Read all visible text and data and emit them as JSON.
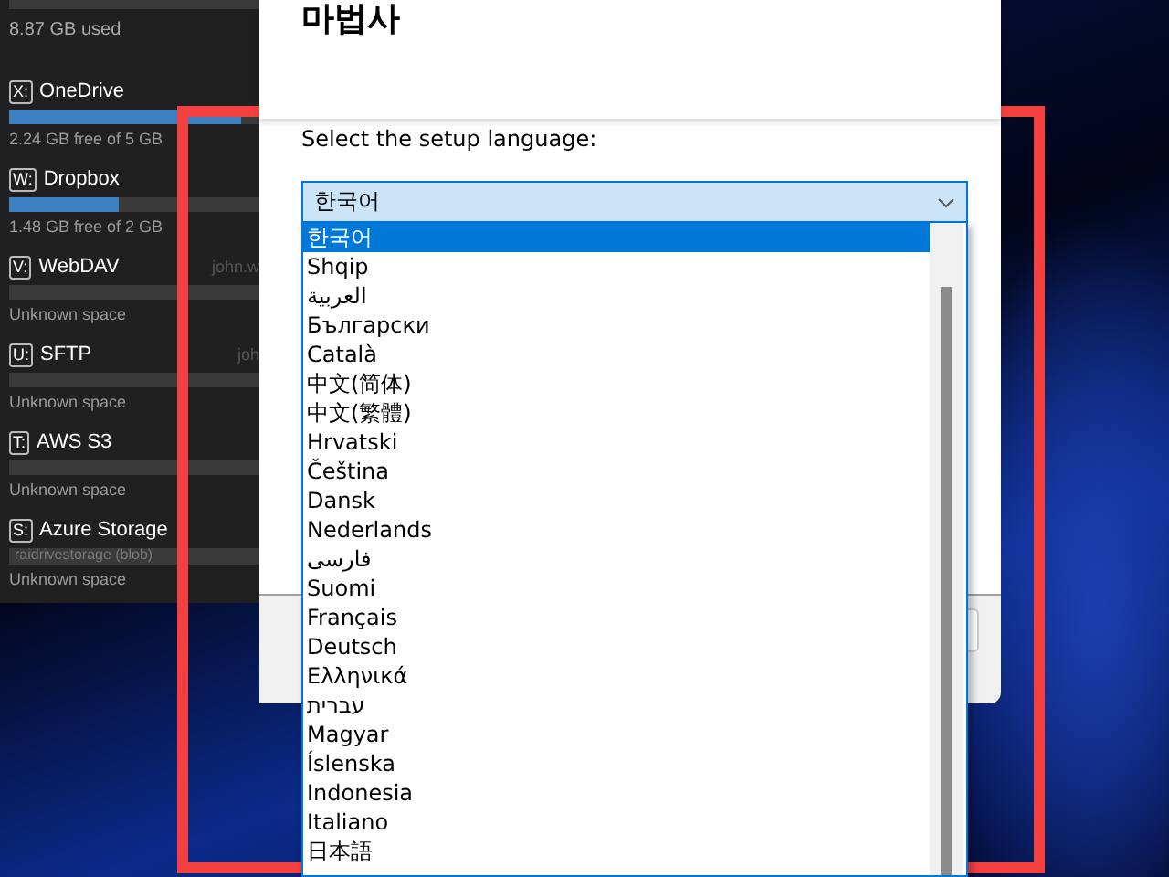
{
  "drive_panel": {
    "top_drive": {
      "used": "8.87 GB used"
    },
    "drives": [
      {
        "letter": "X:",
        "name": "OneDrive",
        "level": 0.93,
        "info": "2.24 GB free of 5 GB"
      },
      {
        "letter": "W:",
        "name": "Dropbox",
        "level": 0.44,
        "info": "1.48 GB free of 2 GB"
      },
      {
        "letter": "V:",
        "name": "WebDAV",
        "account": "john.w",
        "info": "Unknown space"
      },
      {
        "letter": "U:",
        "name": "SFTP",
        "account": "joh",
        "info": "Unknown space"
      },
      {
        "letter": "T:",
        "name": "AWS S3",
        "info": "Unknown space"
      },
      {
        "letter": "S:",
        "name": "Azure Storage",
        "bar_text": "raidrivestorage (blob)",
        "info": "Unknown space"
      }
    ]
  },
  "dialog": {
    "title": "마법사",
    "prompt": "Select the setup language:",
    "language_select": {
      "value": "한국어",
      "expanded": true
    },
    "languages": [
      {
        "label": "한국어",
        "selected": true
      },
      {
        "label": "Shqip",
        "selected": false
      },
      {
        "label": "العربية",
        "selected": false
      },
      {
        "label": "Български",
        "selected": false
      },
      {
        "label": "Català",
        "selected": false
      },
      {
        "label": "中文(简体)",
        "selected": false
      },
      {
        "label": "中文(繁體)",
        "selected": false
      },
      {
        "label": "Hrvatski",
        "selected": false
      },
      {
        "label": "Čeština",
        "selected": false
      },
      {
        "label": "Dansk",
        "selected": false
      },
      {
        "label": "Nederlands",
        "selected": false
      },
      {
        "label": "فارسی",
        "selected": false
      },
      {
        "label": "Suomi",
        "selected": false
      },
      {
        "label": "Français",
        "selected": false
      },
      {
        "label": "Deutsch",
        "selected": false
      },
      {
        "label": "Ελληνικά",
        "selected": false
      },
      {
        "label": "עברית",
        "selected": false
      },
      {
        "label": "Magyar",
        "selected": false
      },
      {
        "label": "Íslenska",
        "selected": false
      },
      {
        "label": "Indonesia",
        "selected": false
      },
      {
        "label": "Italiano",
        "selected": false
      },
      {
        "label": "日本語",
        "selected": false
      }
    ]
  }
}
